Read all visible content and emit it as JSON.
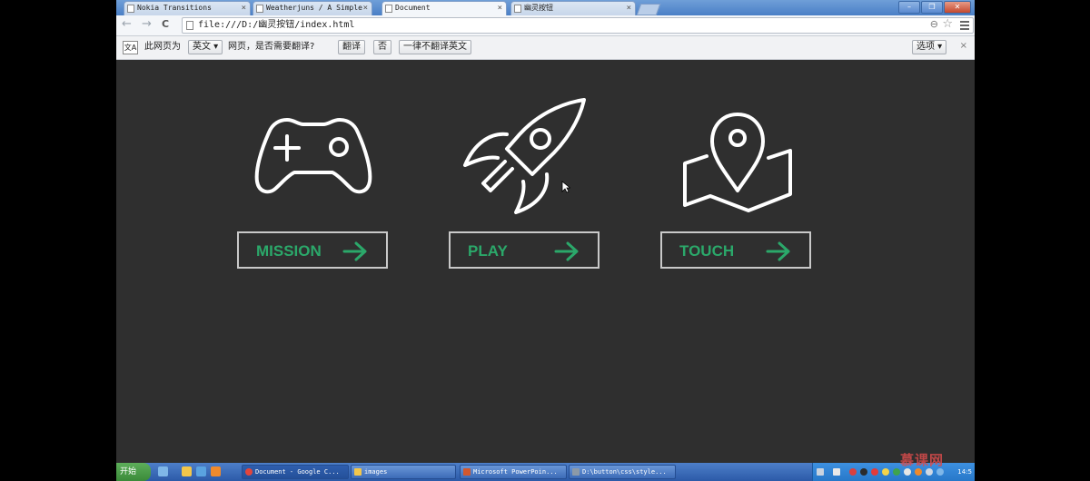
{
  "browser": {
    "tabs": [
      {
        "label": "Nokia Transitions",
        "close": "×"
      },
      {
        "label": "Weatherjuns / A Simple",
        "close": "×"
      },
      {
        "label": "Document",
        "close": "×"
      },
      {
        "label": "幽灵按钮",
        "close": "×"
      }
    ],
    "window_buttons": {
      "minimize": "–",
      "restore": "❐",
      "close": "✕"
    },
    "nav": {
      "back": "←",
      "forward": "→",
      "reload": "C"
    },
    "address": "file:///D:/幽灵按钮/index.html",
    "zoom_icon": "⊖",
    "star_icon": "☆"
  },
  "translate_bar": {
    "icon_text": "文A",
    "prefix": "此网页为",
    "language": "英文 ▾",
    "question": "网页，是否需要翻译?",
    "translate_button": "翻译",
    "no_button": "否",
    "never_button": "一律不翻译英文",
    "options_button": "选项 ▾",
    "close": "×"
  },
  "page": {
    "background": "#2f2f2f",
    "accent_color": "#2ba86a",
    "buttons": [
      {
        "label": "MISSION",
        "icon": "gamepad-icon"
      },
      {
        "label": "PLAY",
        "icon": "rocket-icon"
      },
      {
        "label": "TOUCH",
        "icon": "map-pin-icon"
      }
    ]
  },
  "taskbar": {
    "start": "开始",
    "tasks": [
      {
        "label": "Document - Google C..."
      },
      {
        "label": "images"
      },
      {
        "label": "Microsoft PowerPoin..."
      },
      {
        "label": "D:\\button\\css\\style..."
      }
    ],
    "clock": "14:5",
    "watermark": "慕课网"
  }
}
